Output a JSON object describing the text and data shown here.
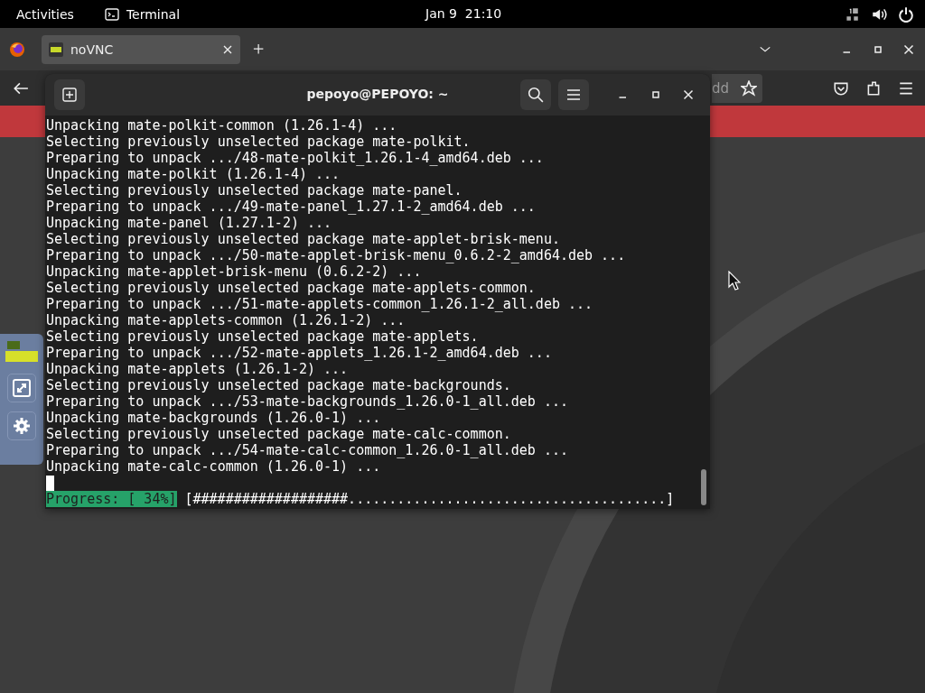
{
  "top_bar": {
    "activities": "Activities",
    "app_name": "Terminal",
    "clock": "Jan 9  21:10"
  },
  "browser": {
    "tabs": [
      {
        "label": "noVNC",
        "selected": true
      }
    ],
    "address_fragment": "dd"
  },
  "terminal": {
    "title": "pepoyo@PEPOYO: ~",
    "lines": [
      "Unpacking mate-polkit-common (1.26.1-4) ...",
      "Selecting previously unselected package mate-polkit.",
      "Preparing to unpack .../48-mate-polkit_1.26.1-4_amd64.deb ...",
      "Unpacking mate-polkit (1.26.1-4) ...",
      "Selecting previously unselected package mate-panel.",
      "Preparing to unpack .../49-mate-panel_1.27.1-2_amd64.deb ...",
      "Unpacking mate-panel (1.27.1-2) ...",
      "Selecting previously unselected package mate-applet-brisk-menu.",
      "Preparing to unpack .../50-mate-applet-brisk-menu_0.6.2-2_amd64.deb ...",
      "Unpacking mate-applet-brisk-menu (0.6.2-2) ...",
      "Selecting previously unselected package mate-applets-common.",
      "Preparing to unpack .../51-mate-applets-common_1.26.1-2_all.deb ...",
      "Unpacking mate-applets-common (1.26.1-2) ...",
      "Selecting previously unselected package mate-applets.",
      "Preparing to unpack .../52-mate-applets_1.26.1-2_amd64.deb ...",
      "Unpacking mate-applets (1.26.1-2) ...",
      "Selecting previously unselected package mate-backgrounds.",
      "Preparing to unpack .../53-mate-backgrounds_1.26.0-1_all.deb ...",
      "Unpacking mate-backgrounds (1.26.0-1) ...",
      "Selecting previously unselected package mate-calc-common.",
      "Preparing to unpack .../54-mate-calc-common_1.26.0-1_all.deb ...",
      "Unpacking mate-calc-common (1.26.0-1) ..."
    ],
    "progress_label": "Progress: [ 34%]",
    "progress_bar": "[###################.......................................]"
  }
}
